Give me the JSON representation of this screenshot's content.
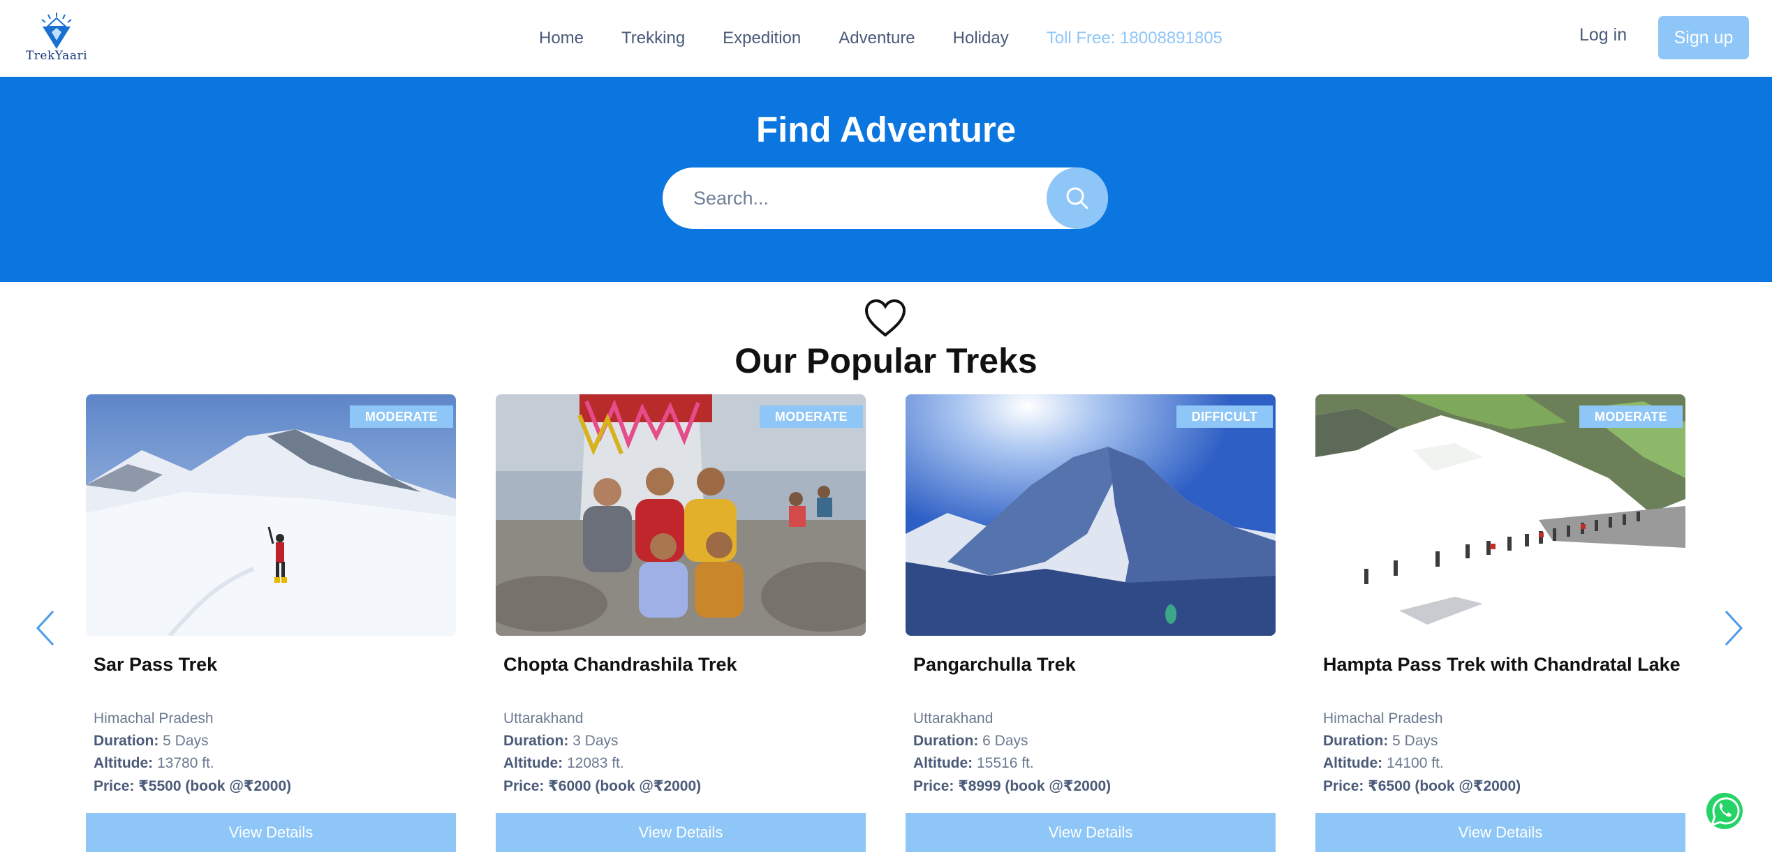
{
  "brand": {
    "logo_text": "TrekYaari"
  },
  "nav": {
    "items": [
      "Home",
      "Trekking",
      "Expedition",
      "Adventure",
      "Holiday"
    ],
    "toll_free": "Toll Free: 18008891805",
    "login": "Log in",
    "signup": "Sign up"
  },
  "hero": {
    "title": "Find Adventure",
    "search_placeholder": "Search..."
  },
  "section": {
    "title": "Our Popular Treks"
  },
  "cards": [
    {
      "title": "Sar Pass Trek",
      "difficulty": "MODERATE",
      "region": "Himachal Pradesh",
      "duration_label": "Duration:",
      "duration": " 5 Days",
      "altitude_label": "Altitude:",
      "altitude": " 13780 ft.",
      "price": "Price: ₹5500 (book @₹2000)",
      "button": "View Details"
    },
    {
      "title": "Chopta Chandrashila Trek",
      "difficulty": "MODERATE",
      "region": "Uttarakhand",
      "duration_label": "Duration:",
      "duration": " 3 Days",
      "altitude_label": "Altitude:",
      "altitude": " 12083 ft.",
      "price": "Price: ₹6000 (book @₹2000)",
      "button": "View Details"
    },
    {
      "title": "Pangarchulla Trek",
      "difficulty": "DIFFICULT",
      "region": "Uttarakhand",
      "duration_label": "Duration:",
      "duration": " 6 Days",
      "altitude_label": "Altitude:",
      "altitude": " 15516 ft.",
      "price": "Price: ₹8999 (book @₹2000)",
      "button": "View Details"
    },
    {
      "title": "Hampta Pass Trek with Chandratal Lake",
      "difficulty": "MODERATE",
      "region": "Himachal Pradesh",
      "duration_label": "Duration:",
      "duration": " 5 Days",
      "altitude_label": "Altitude:",
      "altitude": " 14100 ft.",
      "price": "Price: ₹6500 (book @₹2000)",
      "button": "View Details"
    }
  ],
  "icons": {
    "search": "search-icon",
    "heart": "heart-icon",
    "prev": "chevron-left-icon",
    "next": "chevron-right-icon",
    "whatsapp": "whatsapp-icon"
  },
  "colors": {
    "primary": "#0b76e0",
    "accent": "#8ec6f7",
    "nav_text": "#4a5a78",
    "whatsapp": "#25d366"
  }
}
